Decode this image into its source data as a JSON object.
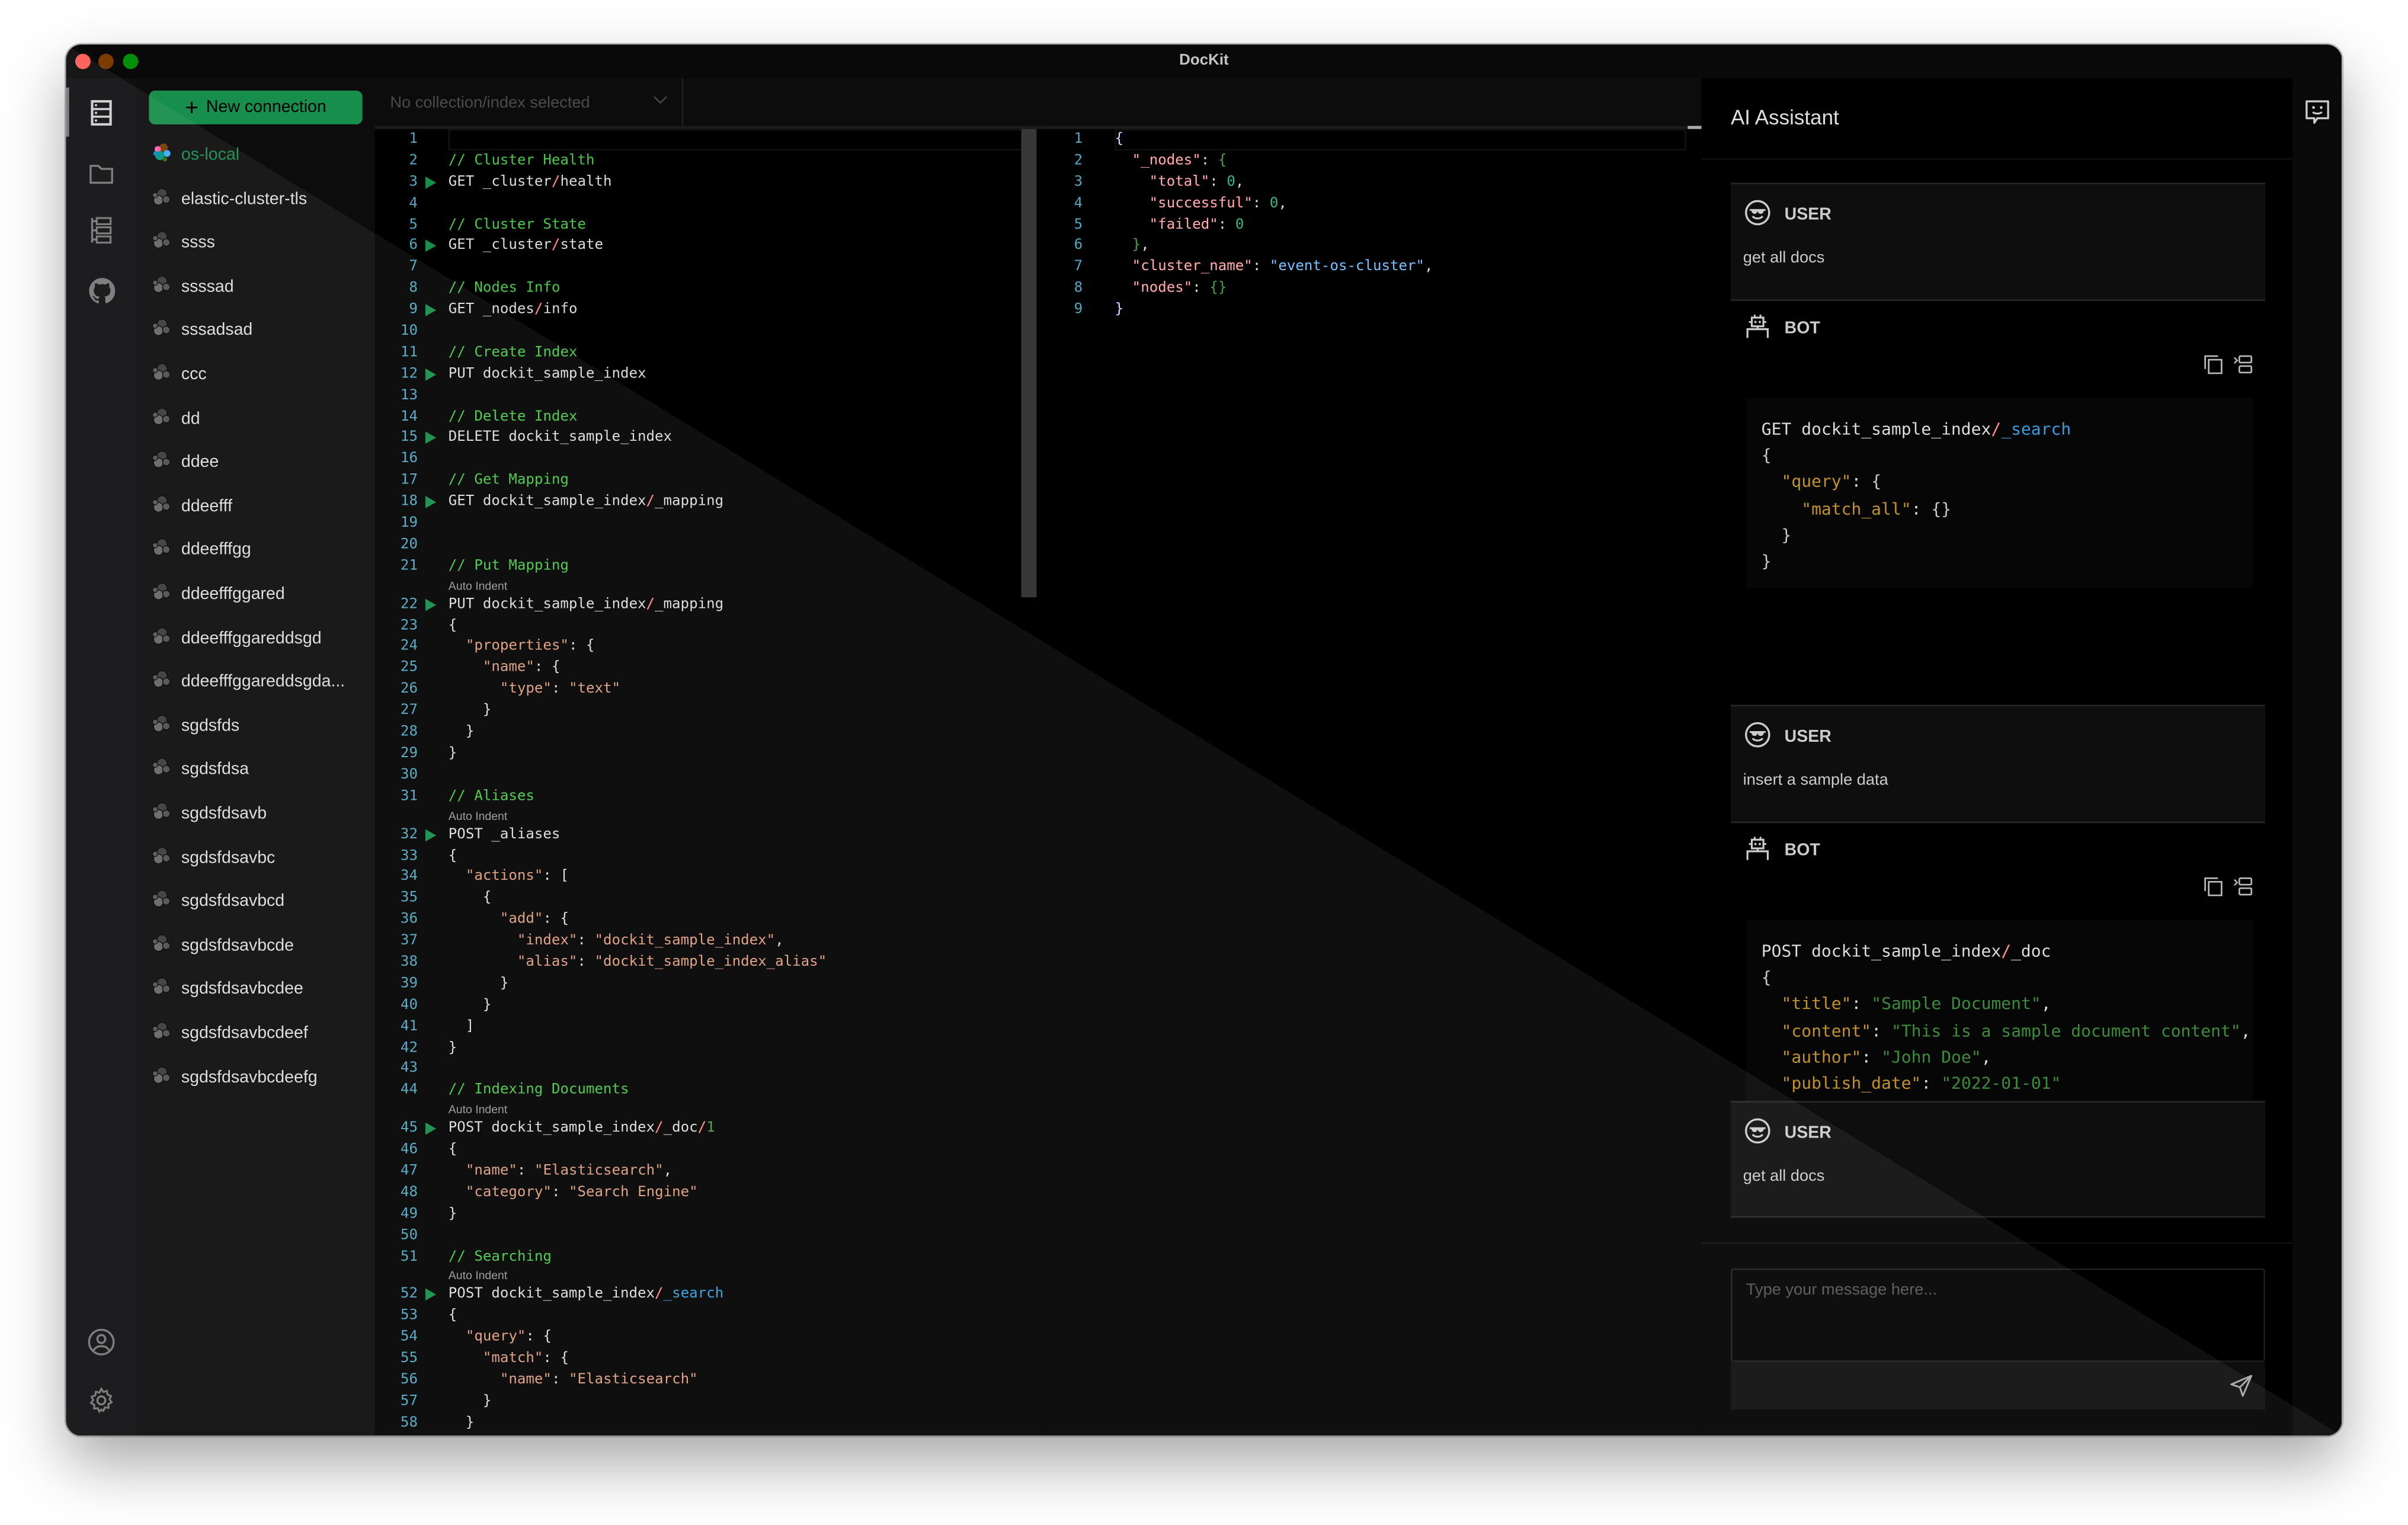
{
  "window": {
    "title": "DocKit"
  },
  "colors": {
    "accent": "#36ad6a",
    "close": "#ff5f57",
    "minimize": "#febc2e",
    "zoom": "#28c840",
    "comment": "#008000",
    "slash": "#e51400",
    "line_number": "#237893"
  },
  "activity_bar": {
    "top_icons": [
      "server-list-icon",
      "folder-icon",
      "tree-icon",
      "github-icon"
    ],
    "bottom_icons": [
      "user-icon",
      "gear-icon"
    ]
  },
  "sidebar": {
    "new_connection_label": "New connection",
    "connections": [
      {
        "name": "os-local",
        "active": true,
        "icon": "opensearch-icon"
      },
      {
        "name": "elastic-cluster-tls"
      },
      {
        "name": "ssss"
      },
      {
        "name": "ssssad"
      },
      {
        "name": "sssadsad"
      },
      {
        "name": "ccc"
      },
      {
        "name": "dd"
      },
      {
        "name": "ddee"
      },
      {
        "name": "ddeefff"
      },
      {
        "name": "ddeefffgg"
      },
      {
        "name": "ddeefffggared"
      },
      {
        "name": "ddeefffggareddsgd"
      },
      {
        "name": "ddeefffggareddsgda..."
      },
      {
        "name": "sgdsfds"
      },
      {
        "name": "sgdsfdsa"
      },
      {
        "name": "sgdsfdsavb"
      },
      {
        "name": "sgdsfdsavbc"
      },
      {
        "name": "sgdsfdsavbcd"
      },
      {
        "name": "sgdsfdsavbcde"
      },
      {
        "name": "sgdsfdsavbcdee"
      },
      {
        "name": "sgdsfdsavbcdeef"
      },
      {
        "name": "sgdsfdsavbcdeefg"
      }
    ]
  },
  "editor": {
    "index_select_placeholder": "No collection/index selected",
    "lines": [
      {
        "n": 1,
        "text": ""
      },
      {
        "n": 2,
        "text": "// Cluster Health"
      },
      {
        "n": 3,
        "text": "GET _cluster/health",
        "run": true
      },
      {
        "n": 4,
        "text": ""
      },
      {
        "n": 5,
        "text": "// Cluster State"
      },
      {
        "n": 6,
        "text": "GET _cluster/state",
        "run": true
      },
      {
        "n": 7,
        "text": ""
      },
      {
        "n": 8,
        "text": "// Nodes Info"
      },
      {
        "n": 9,
        "text": "GET _nodes/info",
        "run": true
      },
      {
        "n": 10,
        "text": ""
      },
      {
        "n": 11,
        "text": "// Create Index"
      },
      {
        "n": 12,
        "text": "PUT dockit_sample_index",
        "run": true
      },
      {
        "n": 13,
        "text": ""
      },
      {
        "n": 14,
        "text": "// Delete Index"
      },
      {
        "n": 15,
        "text": "DELETE dockit_sample_index",
        "run": true
      },
      {
        "n": 16,
        "text": ""
      },
      {
        "n": 17,
        "text": "// Get Mapping"
      },
      {
        "n": 18,
        "text": "GET dockit_sample_index/_mapping",
        "run": true
      },
      {
        "n": 19,
        "text": ""
      },
      {
        "n": 20,
        "text": ""
      },
      {
        "n": 21,
        "text": "// Put Mapping",
        "hint": "Auto Indent"
      },
      {
        "n": 22,
        "text": "PUT dockit_sample_index/_mapping",
        "run": true
      },
      {
        "n": 23,
        "text": "{"
      },
      {
        "n": 24,
        "text": "  \"properties\": {"
      },
      {
        "n": 25,
        "text": "    \"name\": {"
      },
      {
        "n": 26,
        "text": "      \"type\": \"text\""
      },
      {
        "n": 27,
        "text": "    }"
      },
      {
        "n": 28,
        "text": "  }"
      },
      {
        "n": 29,
        "text": "}"
      },
      {
        "n": 30,
        "text": ""
      },
      {
        "n": 31,
        "text": "// Aliases",
        "hint": "Auto Indent"
      },
      {
        "n": 32,
        "text": "POST _aliases",
        "run": true
      },
      {
        "n": 33,
        "text": "{"
      },
      {
        "n": 34,
        "text": "  \"actions\": ["
      },
      {
        "n": 35,
        "text": "    {"
      },
      {
        "n": 36,
        "text": "      \"add\": {"
      },
      {
        "n": 37,
        "text": "        \"index\": \"dockit_sample_index\","
      },
      {
        "n": 38,
        "text": "        \"alias\": \"dockit_sample_index_alias\""
      },
      {
        "n": 39,
        "text": "      }"
      },
      {
        "n": 40,
        "text": "    }"
      },
      {
        "n": 41,
        "text": "  ]"
      },
      {
        "n": 42,
        "text": "}"
      },
      {
        "n": 43,
        "text": ""
      },
      {
        "n": 44,
        "text": "// Indexing Documents",
        "hint": "Auto Indent"
      },
      {
        "n": 45,
        "text": "POST dockit_sample_index/_doc/1",
        "run": true
      },
      {
        "n": 46,
        "text": "{"
      },
      {
        "n": 47,
        "text": "  \"name\": \"Elasticsearch\","
      },
      {
        "n": 48,
        "text": "  \"category\": \"Search Engine\""
      },
      {
        "n": 49,
        "text": "}"
      },
      {
        "n": 50,
        "text": ""
      },
      {
        "n": 51,
        "text": "// Searching",
        "hint": "Auto Indent"
      },
      {
        "n": 52,
        "text": "POST dockit_sample_index/_search",
        "run": true
      },
      {
        "n": 53,
        "text": "{"
      },
      {
        "n": 54,
        "text": "  \"query\": {"
      },
      {
        "n": 55,
        "text": "    \"match\": {"
      },
      {
        "n": 56,
        "text": "      \"name\": \"Elasticsearch\""
      },
      {
        "n": 57,
        "text": "    }"
      },
      {
        "n": 58,
        "text": "  }"
      }
    ]
  },
  "results": {
    "lines": [
      {
        "n": 1,
        "text": "{"
      },
      {
        "n": 2,
        "text": "  \"_nodes\": {"
      },
      {
        "n": 3,
        "text": "    \"total\": 0,"
      },
      {
        "n": 4,
        "text": "    \"successful\": 0,"
      },
      {
        "n": 5,
        "text": "    \"failed\": 0"
      },
      {
        "n": 6,
        "text": "  },"
      },
      {
        "n": 7,
        "text": "  \"cluster_name\": \"event-os-cluster\","
      },
      {
        "n": 8,
        "text": "  \"nodes\": {}"
      },
      {
        "n": 9,
        "text": "}"
      }
    ]
  },
  "chat": {
    "title": "AI Assistant",
    "user_label": "USER",
    "bot_label": "BOT",
    "input_placeholder": "Type your message here...",
    "messages": [
      {
        "role": "user",
        "text": "get all docs"
      },
      {
        "role": "bot",
        "code": [
          "GET dockit_sample_index/_search",
          "{",
          "  \"query\": {",
          "    \"match_all\": {}",
          "  }",
          "}"
        ]
      },
      {
        "role": "user",
        "text": "insert a sample data"
      },
      {
        "role": "bot",
        "code": [
          "POST dockit_sample_index/_doc",
          "{",
          "  \"title\": \"Sample Document\",",
          "  \"content\": \"This is a sample document content\",",
          "  \"author\": \"John Doe\",",
          "  \"publish_date\": \"2022-01-01\""
        ]
      },
      {
        "role": "user",
        "text": "get all docs"
      }
    ]
  }
}
